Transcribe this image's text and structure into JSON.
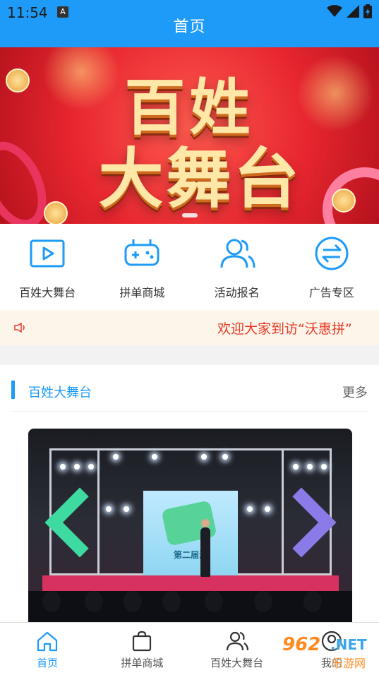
{
  "status": {
    "time": "11:54",
    "a_badge": "A"
  },
  "header": {
    "title": "首页"
  },
  "quick_links": [
    {
      "label": "百姓大舞台",
      "icon": "play-icon"
    },
    {
      "label": "拼单商城",
      "icon": "gamepad-icon"
    },
    {
      "label": "活动报名",
      "icon": "users-icon"
    },
    {
      "label": "广告专区",
      "icon": "exchange-icon"
    }
  ],
  "notice": {
    "text": "欢迎大家到访“沃惠拼”",
    "icon": "speaker-icon"
  },
  "banner": {
    "line1": "百姓",
    "line2": "大舞台"
  },
  "section": {
    "title": "百姓大舞台",
    "more": "更多",
    "screen_text": "第二届海"
  },
  "tabs": [
    {
      "label": "首页",
      "icon": "home-icon",
      "active": true
    },
    {
      "label": "拼单商城",
      "icon": "shopping-bag-icon",
      "active": false
    },
    {
      "label": "百姓大舞台",
      "icon": "users-icon",
      "active": false
    },
    {
      "label": "我的",
      "icon": "user-icon",
      "active": false
    }
  ],
  "watermark": {
    "num": "962",
    "net": ".NET",
    "cn": "乐游网"
  },
  "colors": {
    "accent": "#1e9bf8",
    "notice_text": "#e83a27"
  }
}
